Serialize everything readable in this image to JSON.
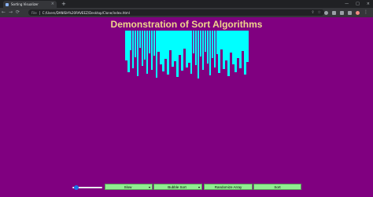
{
  "browser": {
    "tab_title": "Sorting Visualizer",
    "tab_close_glyph": "×",
    "new_tab_glyph": "+",
    "window_controls": [
      "—",
      "□",
      "×"
    ],
    "scheme_label": "File",
    "url": "C:/Users/DANISH%20RAVEEZ/Desktop/Clone/index.html",
    "nav": [
      "←",
      "→",
      "⟳"
    ]
  },
  "page": {
    "title": "Demonstration of Sort Algorithms",
    "bar_color": "#00ffff",
    "background": "#800080",
    "bar_levels": [
      0.62,
      0.86,
      0.41,
      0.78,
      0.55,
      0.93,
      0.35,
      0.72,
      0.6,
      0.88,
      0.47,
      0.8,
      0.52,
      0.97,
      0.44,
      0.69,
      0.84,
      0.58,
      0.9,
      0.4,
      0.74,
      0.63,
      0.95,
      0.5,
      0.82,
      0.37,
      0.76,
      0.66,
      0.89,
      0.46,
      0.71,
      0.98,
      0.53,
      0.81,
      0.43,
      0.67,
      0.92,
      0.57,
      0.75,
      0.49,
      0.87,
      0.39,
      0.79,
      0.61,
      0.94,
      0.45,
      0.7,
      0.85,
      0.56,
      0.77,
      0.42,
      0.91,
      0.64
    ]
  },
  "controls": {
    "speed_slider_value": 0.1,
    "speed_select": "Slow",
    "algorithm_select": "Bubble Sort",
    "randomize_label": "Randomize Array",
    "sort_label": "Sort",
    "caret": "▾"
  }
}
